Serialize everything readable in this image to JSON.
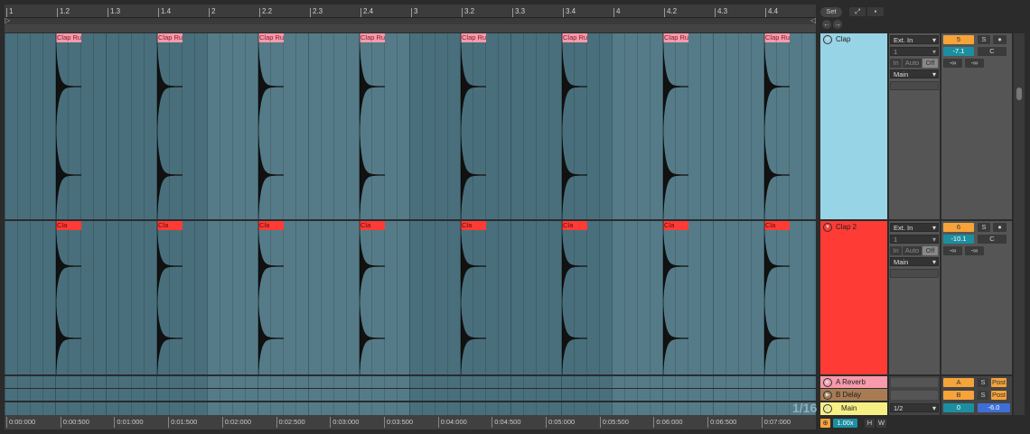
{
  "ruler": {
    "labels": [
      "1",
      "1.2",
      "1.3",
      "1.4",
      "2",
      "2.2",
      "2.3",
      "2.4",
      "3",
      "3.2",
      "3.3",
      "3.4",
      "4",
      "4.2",
      "4.3",
      "4.4"
    ]
  },
  "time_ruler": {
    "labels": [
      "0:00:000",
      "0:00:500",
      "0:01:000",
      "0:01:500",
      "0:02:000",
      "0:02:500",
      "0:03:000",
      "0:03:500",
      "0:04:000",
      "0:04:500",
      "0:05:000",
      "0:05:500",
      "0:06:000",
      "0:06:500",
      "0:07:000"
    ]
  },
  "top_controls": {
    "set_label": "Set",
    "expand_icon": "expand-icon",
    "lock_icon": "lock-icon",
    "prev_icon": "arrow-left-icon",
    "next_icon": "arrow-right-icon"
  },
  "grid_label": "1/16",
  "colors": {
    "clap": "#97d4e6",
    "clap2": "#ff3b35",
    "reverb": "#f79aab",
    "delay": "#a77c54",
    "main": "#f6ef84",
    "lane": "#4c7482"
  },
  "tracks": [
    {
      "name": "Clap",
      "clip_label": "Clap Ru",
      "input_type": "Ext. In",
      "input_channel": "1",
      "monitor": [
        "In",
        "Auto",
        "Off"
      ],
      "output": "Main",
      "number": "5",
      "solo": "S",
      "volume": "-7.1",
      "pan": "C",
      "peak_l": "-∞",
      "peak_r": "-∞"
    },
    {
      "name": "Clap 2",
      "clip_label": "Cla",
      "input_type": "Ext. In",
      "input_channel": "1",
      "monitor": [
        "In",
        "Auto",
        "Off"
      ],
      "output": "Main",
      "number": "6",
      "solo": "S",
      "volume": "-10.1",
      "pan": "C",
      "peak_l": "-∞",
      "peak_r": "-∞"
    }
  ],
  "returns": [
    {
      "name": "A Reverb",
      "letter": "A",
      "solo": "S",
      "post": "Post"
    },
    {
      "name": "B Delay",
      "letter": "B",
      "solo": "S",
      "post": "Post"
    }
  ],
  "main": {
    "name": "Main",
    "cue_out": "1/2",
    "number": "0",
    "volume": "-6.0"
  },
  "footer": {
    "zoom": "1.00x",
    "h_label": "H",
    "w_label": "W"
  }
}
